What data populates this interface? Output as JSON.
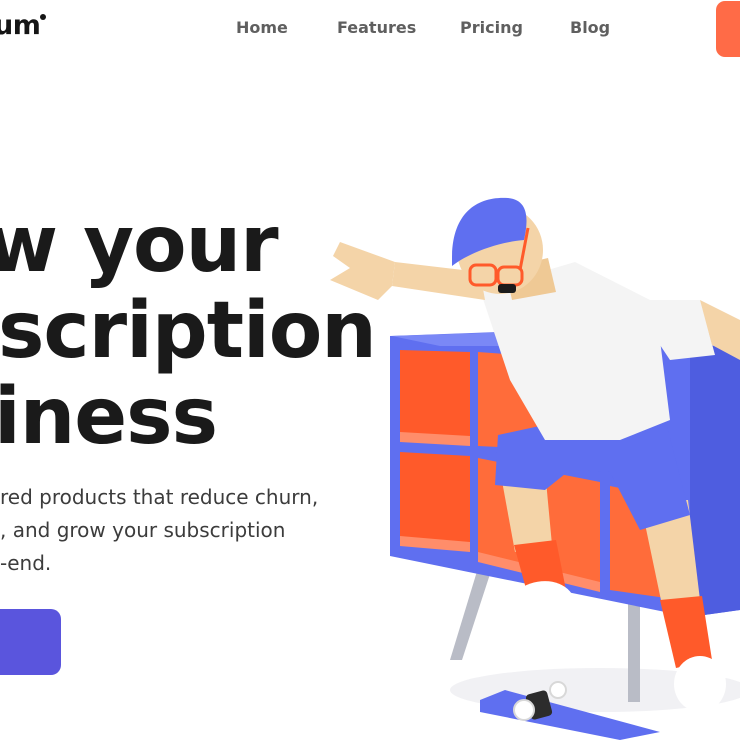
{
  "brand": {
    "name": "um"
  },
  "nav": {
    "items": [
      {
        "label": "Home"
      },
      {
        "label": "Features"
      },
      {
        "label": "Pricing"
      },
      {
        "label": "Blog"
      }
    ]
  },
  "hero": {
    "headline": [
      "w your",
      "scription",
      "iness"
    ],
    "subtext": [
      "red products that reduce churn,",
      ", and grow your subscription",
      "-end."
    ]
  },
  "illustration": {
    "name": "skateboarder-3d-illustration"
  },
  "colors": {
    "accent_orange": "#ff6b47",
    "button_purple": "#5a55dd",
    "shelf_blue": "#5f6ff0",
    "text_dark": "#1a1a1a"
  }
}
